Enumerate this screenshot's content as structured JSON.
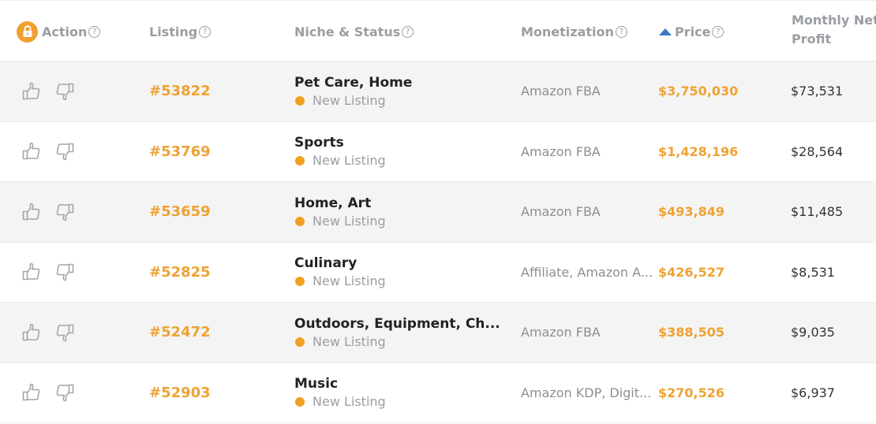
{
  "header": {
    "action": "Action",
    "listing": "Listing",
    "niche_status": "Niche & Status",
    "monetization": "Monetization",
    "price": "Price",
    "monthly_net_profit_line1": "Monthly Net",
    "monthly_net_profit_line2": "Profit",
    "help_glyph": "?",
    "sort_direction": "ascending-indicator"
  },
  "colors": {
    "accent_orange": "#eea234",
    "sort_blue": "#3e78c2",
    "header_text": "#9a9ea3",
    "row_alt_bg": "#f4f4f4"
  },
  "rows": [
    {
      "id": "#53822",
      "niche": "Pet Care, Home",
      "status": "New Listing",
      "monetization": "Amazon FBA",
      "price": "$3,750,030",
      "profit": "$73,531"
    },
    {
      "id": "#53769",
      "niche": "Sports",
      "status": "New Listing",
      "monetization": "Amazon FBA",
      "price": "$1,428,196",
      "profit": "$28,564"
    },
    {
      "id": "#53659",
      "niche": "Home, Art",
      "status": "New Listing",
      "monetization": "Amazon FBA",
      "price": "$493,849",
      "profit": "$11,485"
    },
    {
      "id": "#52825",
      "niche": "Culinary",
      "status": "New Listing",
      "monetization": "Affiliate, Amazon A...",
      "price": "$426,527",
      "profit": "$8,531"
    },
    {
      "id": "#52472",
      "niche": "Outdoors, Equipment, Ch...",
      "status": "New Listing",
      "monetization": "Amazon FBA",
      "price": "$388,505",
      "profit": "$9,035"
    },
    {
      "id": "#52903",
      "niche": "Music",
      "status": "New Listing",
      "monetization": "Amazon KDP, Digit...",
      "price": "$270,526",
      "profit": "$6,937"
    }
  ]
}
